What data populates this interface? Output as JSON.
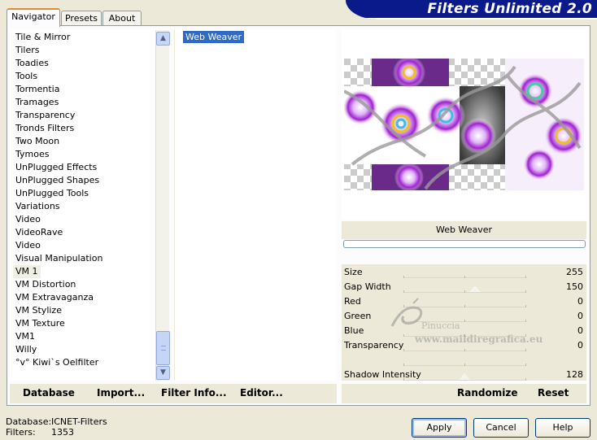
{
  "tabs": [
    {
      "label": "Navigator",
      "active": true
    },
    {
      "label": "Presets",
      "active": false
    },
    {
      "label": "About",
      "active": false
    }
  ],
  "banner": {
    "title": "Filters Unlimited 2.0"
  },
  "categories": [
    "Tile & Mirror",
    "Tilers",
    "Toadies",
    "Tools",
    "Tormentia",
    "Tramages",
    "Transparency",
    "Tronds Filters",
    "Two Moon",
    "Tymoes",
    "UnPlugged Effects",
    "UnPlugged Shapes",
    "UnPlugged Tools",
    "Variations",
    "Video",
    "VideoRave",
    "Video",
    "Visual Manipulation",
    "VM 1",
    "VM Distortion",
    "VM Extravaganza",
    "VM Stylize",
    "VM Texture",
    "VM1",
    "Willy",
    "°v° Kiwi`s Oelfilter"
  ],
  "selected_category": "VM 1",
  "filters": [
    "Web Weaver"
  ],
  "selected_filter": "Web Weaver",
  "filter_name": "Web Weaver",
  "params": [
    {
      "label": "Size",
      "value": "255",
      "slider": 1.0
    },
    {
      "label": "Gap Width",
      "value": "150",
      "slider": 0.588
    },
    {
      "label": "Red",
      "value": "0",
      "slider": 0
    },
    {
      "label": "Green",
      "value": "0",
      "slider": 0
    },
    {
      "label": "Blue",
      "value": "0",
      "slider": 0
    },
    {
      "label": "Transparency",
      "value": "0",
      "slider": 0
    },
    {
      "label": "",
      "value": "",
      "slider": null
    },
    {
      "label": "Shadow Intensity",
      "value": "128",
      "slider": 0.5
    }
  ],
  "left_buttons": {
    "database": "Database",
    "import": "Import...",
    "filter_info": "Filter Info...",
    "editor": "Editor..."
  },
  "right_buttons": {
    "randomize": "Randomize",
    "reset": "Reset"
  },
  "status": {
    "database_label": "Database:",
    "database_value": "ICNET-Filters",
    "filters_label": "Filters:",
    "filters_value": "1353"
  },
  "dialog_buttons": {
    "apply": "Apply",
    "cancel": "Cancel",
    "help": "Help"
  },
  "watermark": {
    "line1": "Pinuccia",
    "line2": "www.maildiregrafica.eu"
  },
  "colors": {
    "banner": "#0a1a8a",
    "selection": "#316ac5",
    "dialog_bg": "#ece9d8"
  }
}
